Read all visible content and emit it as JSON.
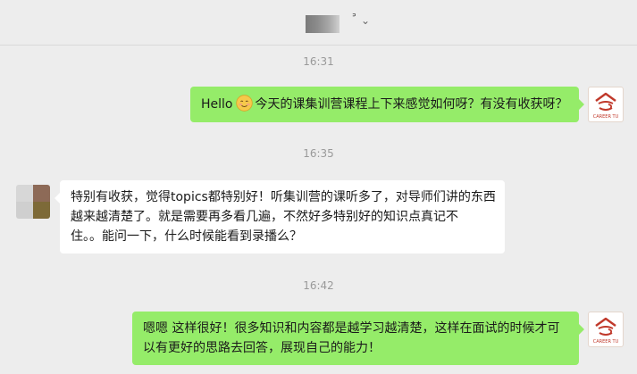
{
  "header": {
    "title_mark": "ᐣ",
    "chevron": "⌄"
  },
  "brand_avatar": {
    "caption": "CAREER TU"
  },
  "messages": [
    {
      "time": "16:31",
      "side": "sent",
      "prefix": "Hello",
      "emoji": "smiling-face-emoji",
      "text": "今天的课集训营课程上下来感觉如何呀？有没有收获呀？"
    },
    {
      "time": "16:35",
      "side": "received",
      "lines": [
        "特别有收获，觉得topics都特别好！听集训营的课听多了，对导师们讲的东西",
        "越来越清楚了。就是需要再多看几遍，不然好多特别好的知识点真记不",
        "住。。能问一下，什么时候能看到录播么？"
      ]
    },
    {
      "time": "16:42",
      "side": "sent",
      "lines": [
        "嗯嗯 这样很好！很多知识和内容都是越学习越清楚，这样在面试的时候才可",
        "以有更好的思路去回答，展现自己的能力！"
      ]
    }
  ],
  "colors": {
    "background": "#ededed",
    "sent_bubble": "#95ec69",
    "received_bubble": "#ffffff",
    "time_text": "#9a9a9a",
    "brand_red": "#c0392b"
  }
}
